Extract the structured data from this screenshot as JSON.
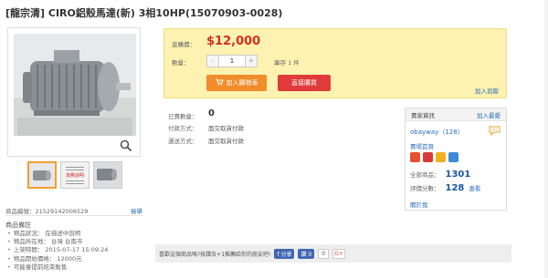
{
  "title": "[龍宗清] CIRO鋁殼馬達(新) 3相10HP(15070903-0028)",
  "gallery": {
    "thumb_tag": "運費說明",
    "item_no_label": "商品編號：",
    "item_no": "21529142006529",
    "report_label": "檢舉"
  },
  "notes": {
    "heading": "商品備註",
    "items": [
      "物品狀況： 在描述中說明",
      "物品所在地： 台灣 台南市",
      "上架時間： 2015-07-17 15:09:24",
      "物品開始價格： 12000元",
      "可能會提前結束販售"
    ]
  },
  "pricebox": {
    "price_label": "直購價：",
    "price": "$12,000",
    "qty_label": "數量：",
    "qty_minus": "-",
    "qty_value": "1",
    "qty_plus": "+",
    "stock": "庫存 1 件",
    "cart_label": "加入購物車",
    "buy_label": "直接購買",
    "track_label": "加入追蹤"
  },
  "info": {
    "sold_label": "已賣數量：",
    "sold_value": "0",
    "pay_label": "付款方式：",
    "pay_value": "面交取貨付款",
    "ship_label": "運送方式：",
    "ship_value": "面交取貨付款"
  },
  "seller": {
    "header": "賣家資訊",
    "fav_label": "加入最愛",
    "name": "obayway（128）",
    "home_label": "賣場首頁",
    "total_label": "全部商品：",
    "total": "1301",
    "score_label": "評價分數：",
    "score": "128",
    "score_q": "查看",
    "shop_label": "關於我"
  },
  "share": {
    "text": "喜歡這個商品嗎?按讚及+1推薦給你的朋友吧!",
    "fb_share": "f 分享",
    "fb_like": "讚 0",
    "gplus": "G+",
    "zero": "0"
  },
  "colors": {
    "price_red": "#d62e1e",
    "cart_orange": "#f08c2a",
    "buy_red": "#e03b3b",
    "link_blue": "#2a6ebb",
    "pricebox_yellow": "#fdf2b0"
  }
}
